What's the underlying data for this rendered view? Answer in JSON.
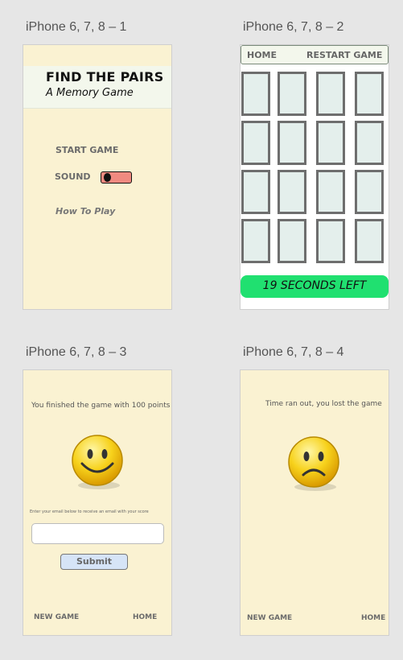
{
  "artboards": [
    {
      "label": "iPhone 6, 7, 8 – 1"
    },
    {
      "label": "iPhone 6, 7, 8 – 2"
    },
    {
      "label": "iPhone 6, 7, 8 – 3"
    },
    {
      "label": "iPhone 6, 7, 8 – 4"
    }
  ],
  "menu": {
    "title": "FIND THE PAIRS",
    "subtitle": "A Memory Game",
    "start": "START GAME",
    "sound_label": "SOUND",
    "how_to": "How To Play"
  },
  "game": {
    "home": "HOME",
    "restart": "RESTART GAME",
    "timer": "19 SECONDS LEFT"
  },
  "win": {
    "message": "You finished the game with  100 points",
    "email_prompt": "Enter your email below to receive an email with your score",
    "email_value": "",
    "submit": "Submit",
    "new_game": "NEW GAME",
    "home": "HOME"
  },
  "lose": {
    "message": "Time ran out, you lost the game",
    "new_game": "NEW GAME",
    "home": "HOME"
  },
  "colors": {
    "cream": "#faf2d2",
    "timer_green": "#20e070",
    "toggle_red": "#f08a80",
    "card_fill": "#e4efec"
  }
}
